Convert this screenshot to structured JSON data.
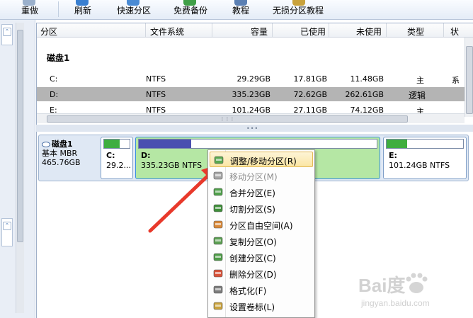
{
  "toolbar": {
    "items": [
      {
        "label": "重做"
      },
      {
        "label": "刷新"
      },
      {
        "label": "快速分区"
      },
      {
        "label": "免费备份"
      },
      {
        "label": "教程"
      },
      {
        "label": "无损分区教程"
      }
    ]
  },
  "table": {
    "columns": [
      "分区",
      "文件系统",
      "容量",
      "已使用",
      "未使用",
      "类型",
      "状"
    ],
    "disk_label": "磁盘1",
    "rows": [
      {
        "partition": "C:",
        "fs": "NTFS",
        "capacity": "29.29GB",
        "used": "17.81GB",
        "free": "11.48GB",
        "type": "主",
        "status": "系"
      },
      {
        "partition": "D:",
        "fs": "NTFS",
        "capacity": "335.23GB",
        "used": "72.62GB",
        "free": "262.61GB",
        "type": "逻辑",
        "status": ""
      },
      {
        "partition": "E:",
        "fs": "NTFS",
        "capacity": "101.24GB",
        "used": "27.11GB",
        "free": "74.12GB",
        "type": "主",
        "status": ""
      }
    ]
  },
  "diskmap": {
    "disk": {
      "name": "磁盘1",
      "type": "基本 MBR",
      "size": "465.76GB"
    },
    "partitions": [
      {
        "label": "C:",
        "info": "29.2...",
        "used_fraction": 0.61,
        "color": "#3fae3f"
      },
      {
        "label": "D:",
        "info": "335.23GB NTFS",
        "used_fraction": 0.22,
        "color": "#4a4fb0"
      },
      {
        "label": "E:",
        "info": "101.24GB NTFS",
        "used_fraction": 0.27,
        "color": "#3fae3f"
      }
    ]
  },
  "context_menu": {
    "items": [
      {
        "label": "调整/移动分区(R)",
        "icon": "resize-move-icon",
        "highlighted": true,
        "disabled": false
      },
      {
        "label": "移动分区(M)",
        "icon": "move-icon",
        "highlighted": false,
        "disabled": true
      },
      {
        "label": "合并分区(E)",
        "icon": "merge-icon",
        "highlighted": false,
        "disabled": false
      },
      {
        "label": "切割分区(S)",
        "icon": "split-icon",
        "highlighted": false,
        "disabled": false
      },
      {
        "label": "分区自由空间(A)",
        "icon": "allocate-free-space-icon",
        "highlighted": false,
        "disabled": false
      },
      {
        "label": "复制分区(O)",
        "icon": "copy-icon",
        "highlighted": false,
        "disabled": false
      },
      {
        "label": "创建分区(C)",
        "icon": "create-icon",
        "highlighted": false,
        "disabled": false
      },
      {
        "label": "删除分区(D)",
        "icon": "delete-icon",
        "highlighted": false,
        "disabled": false
      },
      {
        "label": "格式化(F)",
        "icon": "format-icon",
        "highlighted": false,
        "disabled": false
      },
      {
        "label": "设置卷标(L)",
        "icon": "label-icon",
        "highlighted": false,
        "disabled": false
      }
    ]
  },
  "watermark": {
    "brand": "Bai度",
    "sub": "jingyan.baidu.com"
  },
  "colors": {
    "accent": "#3c8ee0",
    "selected_row": "#b4b4b4",
    "partition_selected": "#b5e7a4",
    "arrow": "#e8392b"
  }
}
